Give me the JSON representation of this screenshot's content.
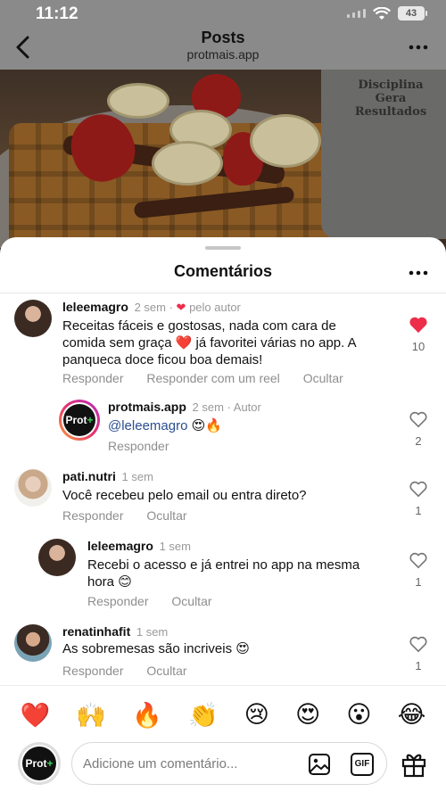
{
  "status": {
    "time": "11:12",
    "battery": "43"
  },
  "nav": {
    "title": "Posts",
    "subtitle": "protmais.app"
  },
  "photo": {
    "mug_text": "Disciplina Gera Resultados"
  },
  "sheet": {
    "title": "Comentários"
  },
  "comments": [
    {
      "user": "leleemagro",
      "time": "2 sem",
      "badge": "pelo autor",
      "text": "Receitas fáceis e gostosas, nada com cara de comida sem graça ❤️ já favoritei várias no app. A panqueca doce ficou boa demais!",
      "actions": [
        "Responder",
        "Responder com um reel",
        "Ocultar"
      ],
      "likes": "10",
      "liked": true
    },
    {
      "user": "protmais.app",
      "time": "2 sem",
      "badge": "Autor",
      "mention": "@leleemagro",
      "text": " 😍🔥",
      "actions": [
        "Responder"
      ],
      "likes": "2",
      "liked": false
    },
    {
      "user": "pati.nutri",
      "time": "1 sem",
      "text": "Você recebeu pelo email ou entra direto?",
      "actions": [
        "Responder",
        "Ocultar"
      ],
      "likes": "1",
      "liked": false
    },
    {
      "user": "leleemagro",
      "time": "1 sem",
      "text": "Recebi o acesso e já entrei no app na mesma hora 😊",
      "actions": [
        "Responder",
        "Ocultar"
      ],
      "likes": "1",
      "liked": false
    },
    {
      "user": "renatinhafit",
      "time": "1 sem",
      "text": "As sobremesas são incriveis 😍",
      "actions": [
        "Responder",
        "Ocultar"
      ],
      "likes": "1",
      "liked": false
    }
  ],
  "logo": {
    "text": "Prot",
    "plus": "+"
  },
  "reactions": [
    "❤️",
    "🙌",
    "🔥",
    "👏",
    "😢",
    "😍",
    "😮",
    "😂"
  ],
  "composer": {
    "placeholder": "Adicione um comentário...",
    "gif_label": "GIF"
  },
  "colors": {
    "like_red": "#ed2d4a",
    "mention_blue": "#2b4d8e",
    "logo_green": "#3ad35d"
  }
}
